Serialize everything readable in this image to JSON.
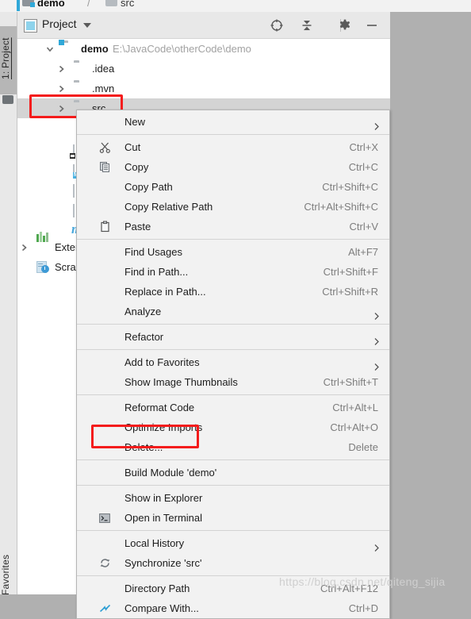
{
  "breadcrumb": {
    "project": "demo",
    "separator": "/",
    "current": "src"
  },
  "left_strip": {
    "project_tab": "1: Project",
    "favorites_tab": "Favorites"
  },
  "tool_window": {
    "title": "Project",
    "actions": [
      {
        "name": "locate-icon",
        "tooltip": "Select Opened File"
      },
      {
        "name": "collapse-all-icon",
        "tooltip": "Collapse All"
      },
      {
        "name": "gear-icon",
        "tooltip": "Settings"
      },
      {
        "name": "minimize-icon",
        "tooltip": "Hide"
      }
    ]
  },
  "tree": [
    {
      "label": "demo",
      "path": "E:\\JavaCode\\otherCode\\demo",
      "icon": "module-folder-icon",
      "expanded": true,
      "indent": 0,
      "bold": true
    },
    {
      "label": ".idea",
      "path": "",
      "icon": "folder-icon",
      "expanded": false,
      "indent": 1,
      "bold": false
    },
    {
      "label": ".mvn",
      "path": "",
      "icon": "folder-icon",
      "expanded": false,
      "indent": 1,
      "bold": false
    },
    {
      "label": "src",
      "path": "",
      "icon": "folder-icon",
      "expanded": false,
      "indent": 1,
      "bold": false,
      "selected": true
    },
    {
      "label": "",
      "path": "",
      "icon": "git-icon",
      "expanded": false,
      "indent": 1,
      "bold": false
    },
    {
      "label": "",
      "path": "",
      "icon": "file-cmd-icon",
      "expanded": false,
      "indent": 1,
      "bold": false
    },
    {
      "label": "",
      "path": "",
      "icon": "markdown-file-icon",
      "expanded": false,
      "indent": 1,
      "bold": false
    },
    {
      "label": "",
      "path": "",
      "icon": "file-icon",
      "expanded": false,
      "indent": 1,
      "bold": false
    },
    {
      "label": "",
      "path": "",
      "icon": "file-icon",
      "expanded": false,
      "indent": 1,
      "bold": false
    },
    {
      "label": "",
      "path": "",
      "icon": "maven-icon",
      "expanded": false,
      "indent": 1,
      "bold": false
    },
    {
      "label": "External Libraries",
      "path": "",
      "icon": "libraries-icon",
      "expanded": false,
      "indent": 0,
      "bold": false
    },
    {
      "label": "Scratches and Consoles",
      "path": "",
      "icon": "scratches-icon",
      "expanded": false,
      "indent": 0,
      "bold": false
    }
  ],
  "context_menu": {
    "groups": [
      [
        {
          "label": "New",
          "shortcut": "",
          "submenu": true,
          "icon": "",
          "mnemonic": "N"
        }
      ],
      [
        {
          "label": "Cut",
          "shortcut": "Ctrl+X",
          "submenu": false,
          "icon": "cut-icon",
          "mnemonic": "t"
        },
        {
          "label": "Copy",
          "shortcut": "Ctrl+C",
          "submenu": false,
          "icon": "copy-icon",
          "mnemonic": "C"
        },
        {
          "label": "Copy Path",
          "shortcut": "Ctrl+Shift+C",
          "submenu": false,
          "icon": "",
          "mnemonic": "o"
        },
        {
          "label": "Copy Relative Path",
          "shortcut": "Ctrl+Alt+Shift+C",
          "submenu": false,
          "icon": "",
          "mnemonic": "y"
        },
        {
          "label": "Paste",
          "shortcut": "Ctrl+V",
          "submenu": false,
          "icon": "paste-icon",
          "mnemonic": "P"
        }
      ],
      [
        {
          "label": "Find Usages",
          "shortcut": "Alt+F7",
          "submenu": false,
          "icon": "",
          "mnemonic": "U"
        },
        {
          "label": "Find in Path...",
          "shortcut": "Ctrl+Shift+F",
          "submenu": false,
          "icon": "",
          "mnemonic": "P"
        },
        {
          "label": "Replace in Path...",
          "shortcut": "Ctrl+Shift+R",
          "submenu": false,
          "icon": "",
          "mnemonic": "a"
        },
        {
          "label": "Analyze",
          "shortcut": "",
          "submenu": true,
          "icon": "",
          "mnemonic": "z"
        }
      ],
      [
        {
          "label": "Refactor",
          "shortcut": "",
          "submenu": true,
          "icon": "",
          "mnemonic": "R"
        }
      ],
      [
        {
          "label": "Add to Favorites",
          "shortcut": "",
          "submenu": true,
          "icon": "",
          "mnemonic": "F"
        },
        {
          "label": "Show Image Thumbnails",
          "shortcut": "Ctrl+Shift+T",
          "submenu": false,
          "icon": "",
          "mnemonic": ""
        }
      ],
      [
        {
          "label": "Reformat Code",
          "shortcut": "Ctrl+Alt+L",
          "submenu": false,
          "icon": "",
          "mnemonic": "R"
        },
        {
          "label": "Optimize Imports",
          "shortcut": "Ctrl+Alt+O",
          "submenu": false,
          "icon": "",
          "mnemonic": "z"
        },
        {
          "label": "Delete...",
          "shortcut": "Delete",
          "submenu": false,
          "icon": "",
          "mnemonic": "D",
          "highlighted": true
        }
      ],
      [
        {
          "label": "Build Module 'demo'",
          "shortcut": "",
          "submenu": false,
          "icon": "",
          "mnemonic": "M"
        }
      ],
      [
        {
          "label": "Show in Explorer",
          "shortcut": "",
          "submenu": false,
          "icon": "",
          "mnemonic": ""
        },
        {
          "label": "Open in Terminal",
          "shortcut": "",
          "submenu": false,
          "icon": "terminal-icon",
          "mnemonic": ""
        }
      ],
      [
        {
          "label": "Local History",
          "shortcut": "",
          "submenu": true,
          "icon": "",
          "mnemonic": "H"
        },
        {
          "label": "Synchronize 'src'",
          "shortcut": "",
          "submenu": false,
          "icon": "sync-icon",
          "mnemonic": ""
        }
      ],
      [
        {
          "label": "Directory Path",
          "shortcut": "Ctrl+Alt+F12",
          "submenu": false,
          "icon": "",
          "mnemonic": "P"
        },
        {
          "label": "Compare With...",
          "shortcut": "Ctrl+D",
          "submenu": false,
          "icon": "compare-icon",
          "mnemonic": ""
        }
      ]
    ]
  },
  "watermark": "https://blog.csdn.net/qiteng_sijia",
  "colors": {
    "highlight_red": "#f41c1c",
    "menu_bg": "#f2f2f2",
    "panel_bg": "#e8e8e8",
    "tree_bg": "#ffffff",
    "selection": "#d4d4d4",
    "editor_bg": "#b0b0b0",
    "shortcut_text": "#7d7d7d",
    "path_text": "#a2a2a2"
  }
}
